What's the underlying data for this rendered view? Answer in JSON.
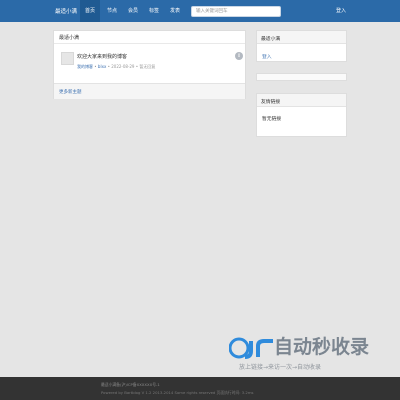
{
  "nav": {
    "brand": "最适小满",
    "items": [
      "首页",
      "节点",
      "会员",
      "标签",
      "发表"
    ],
    "search_placeholder": "输入关键词回车",
    "login": "登入"
  },
  "main": {
    "title": "最适小满",
    "topic": {
      "title": "欢迎大家来到我的博客",
      "author": "我的博客",
      "sep1": "•",
      "node": "blxx",
      "sep2": "•",
      "date": "2022-08-29",
      "sep3": "•",
      "reply_status": "暂无回复",
      "badge": "0"
    },
    "more_link": "更多新主题"
  },
  "sidebar": {
    "box1": {
      "title": "最适小满",
      "link": "登入"
    },
    "box3": {
      "title": "友情链接",
      "text": "暂无链接"
    }
  },
  "footer": {
    "line1": "最适小满备(沪)ICP备XXXXXX号-1",
    "line2": "Powered by Bartblog V 1.2 2013-2014 Some rights reserved 页面执行时间: 3.2ms"
  },
  "watermark": {
    "title": "自动秒收录",
    "subtitle": "放上链接→来访一次→自动收录"
  },
  "colors": {
    "nav_bg": "#2b6aa8",
    "link": "#3a6fb0",
    "page_bg": "#e5e5e5",
    "footer_bg": "#333333"
  }
}
